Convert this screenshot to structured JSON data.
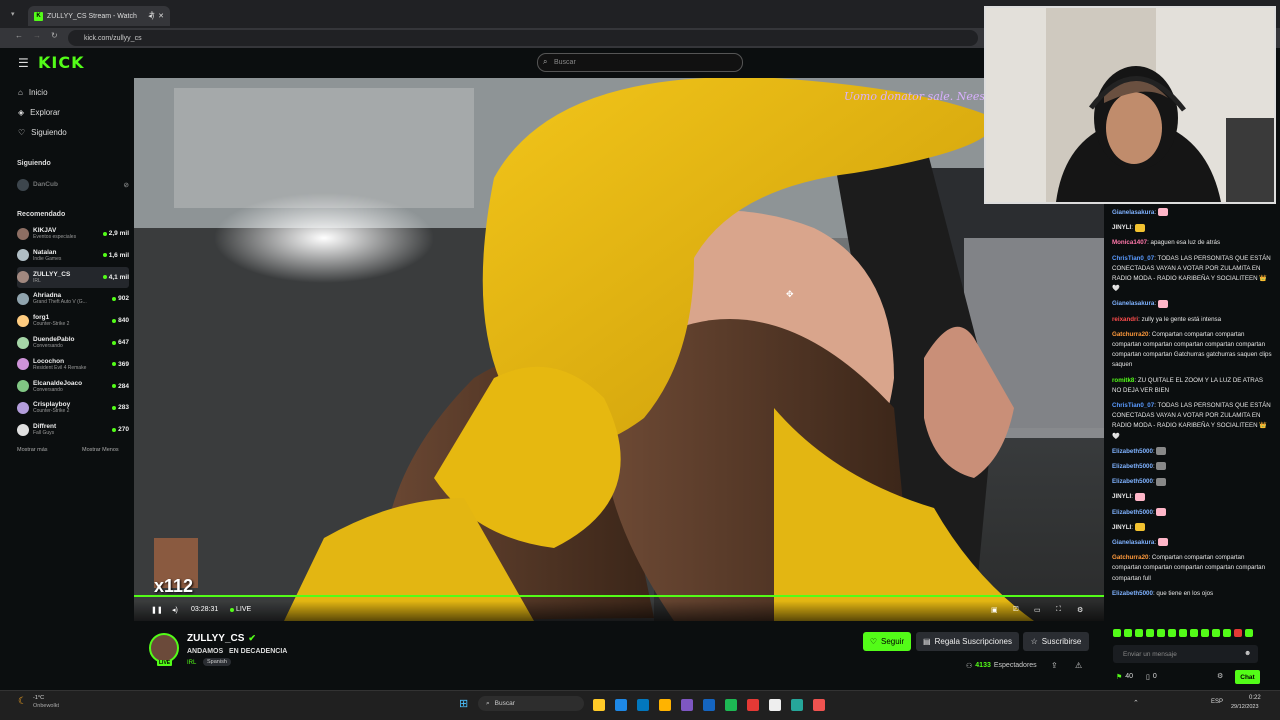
{
  "browser": {
    "tab_title": "ZULLYY_CS Stream - Watch",
    "url": "kick.com/zullyy_cs"
  },
  "header": {
    "logo": "KICK",
    "search_placeholder": "Buscar"
  },
  "sidebar": {
    "nav": [
      {
        "label": "Inicio",
        "icon": "home-icon"
      },
      {
        "label": "Explorar",
        "icon": "compass-icon"
      },
      {
        "label": "Siguiendo",
        "icon": "heart-icon"
      }
    ],
    "following_heading": "Siguiendo",
    "following": [
      {
        "name": "DanCub"
      }
    ],
    "recommended_heading": "Recomendado",
    "recommended": [
      {
        "name": "KIKJAV",
        "category": "Eventos especiales",
        "viewers": "2,9 mil"
      },
      {
        "name": "Natalan",
        "category": "Indie Games",
        "viewers": "1,6 mil"
      },
      {
        "name": "ZULLYY_CS",
        "category": "IRL",
        "viewers": "4,1 mil"
      },
      {
        "name": "Ahriadna",
        "category": "Grand Theft Auto V (G...",
        "viewers": "902"
      },
      {
        "name": "forg1",
        "category": "Counter-Strike 2",
        "viewers": "840"
      },
      {
        "name": "DuendePablo",
        "category": "Conversando",
        "viewers": "647"
      },
      {
        "name": "Locochon",
        "category": "Resident Evil 4 Remake",
        "viewers": "369"
      },
      {
        "name": "ElcanaldeJoaco",
        "category": "Conversando",
        "viewers": "284"
      },
      {
        "name": "Crisplayboy",
        "category": "Counter-Strike 2",
        "viewers": "283"
      },
      {
        "name": "Diffrent",
        "category": "Fall Guys",
        "viewers": "270"
      }
    ],
    "show_more": "Mostrar más",
    "show_less": "Mostrar Menos"
  },
  "player": {
    "overlay_text": "Uomo donator sale. Nees",
    "sticker_text": "x112",
    "time": "03:28:31",
    "live_label": "LIVE"
  },
  "stream": {
    "streamer": "ZULLYY_CS",
    "title": "ANDAMOS   EN DECADENCIA",
    "category": "IRL",
    "tag": "Spanish",
    "live_badge": "LIVE",
    "follow_label": "Seguir",
    "gift_label": "Regala Suscripciones",
    "subscribe_label": "Suscribirse",
    "viewers": "4133",
    "viewers_label": "Espectadores"
  },
  "chat": {
    "messages": [
      {
        "user": "Gianelasakura",
        "text": "",
        "color": "#7fb2ff",
        "emote": "#ffb6c8"
      },
      {
        "user": "JINYLI",
        "text": "",
        "color": "#e6e6e6",
        "emote": "#f2c230"
      },
      {
        "user": "Monica1407",
        "text": "apaguen esa luz de atrás",
        "color": "#ff77aa"
      },
      {
        "user": "ChrisTian0_07",
        "text": "TODAS LAS PERSONITAS QUE ESTÁN CONECTADAS VAYAN A VOTAR POR ZULAMITA EN RADIO MODA - RADIO KARIBEÑA Y SOCIALITEEN 👑 🤍",
        "color": "#5a9bff"
      },
      {
        "user": "Gianelasakura",
        "text": "",
        "color": "#7fb2ff",
        "emote": "#ffb6c8"
      },
      {
        "user": "reixandri",
        "text": "zully ya le gente está intensa",
        "color": "#ff4d4d"
      },
      {
        "user": "Gatchurra20",
        "text": "Compartan compartan compartan compartan compartan compartan compartan compartan compartan compartan Gatchurras gatchurras saquen clips saquen",
        "color": "#ff9a3c"
      },
      {
        "user": "romitk8",
        "text": "ZU QUITALE EL ZOOM Y LA LUZ DE ATRAS NO DEJA VER BIEN",
        "color": "#53fc18"
      },
      {
        "user": "ChrisTian0_07",
        "text": "TODAS LAS PERSONITAS QUE ESTÁN CONECTADAS VAYAN A VOTAR POR ZULAMITA EN RADIO MODA - RADIO KARIBEÑA Y SOCIALITEEN 👑 🤍",
        "color": "#5a9bff"
      },
      {
        "user": "Elizabeth5000",
        "text": "",
        "color": "#7fb2ff",
        "emote": "#888888"
      },
      {
        "user": "Elizabeth5000",
        "text": "",
        "color": "#7fb2ff",
        "emote": "#888888"
      },
      {
        "user": "Elizabeth5000",
        "text": "",
        "color": "#7fb2ff",
        "emote": "#888888"
      },
      {
        "user": "JINYLI",
        "text": "",
        "color": "#e6e6e6",
        "emote": "#ffb6c8"
      },
      {
        "user": "Elizabeth5000",
        "text": "",
        "color": "#7fb2ff",
        "emote": "#ffb6c8"
      },
      {
        "user": "JINYLI",
        "text": "",
        "color": "#e6e6e6",
        "emote": "#f2c230"
      },
      {
        "user": "Gianelasakura",
        "text": "",
        "color": "#7fb2ff",
        "emote": "#ffb6c8"
      },
      {
        "user": "Gatchurra20",
        "text": "Compartan compartan compartan compartan compartan compartan compartan compartan compartan full",
        "color": "#ff9a3c"
      },
      {
        "user": "Elizabeth5000",
        "text": "que tiene en los ojos",
        "color": "#7fb2ff"
      }
    ],
    "input_placeholder": "Enviar un mensaje",
    "points": "40",
    "count": "0",
    "send_label": "Chat"
  },
  "taskbar": {
    "weather_temp": "-1°C",
    "weather_desc": "Onbewolkt",
    "search_placeholder": "Buscar",
    "lang": "ESP",
    "time": "0:22",
    "date": "29/12/2023"
  },
  "colors": {
    "accent": "#53fc18",
    "background": "#0b0e0f"
  }
}
